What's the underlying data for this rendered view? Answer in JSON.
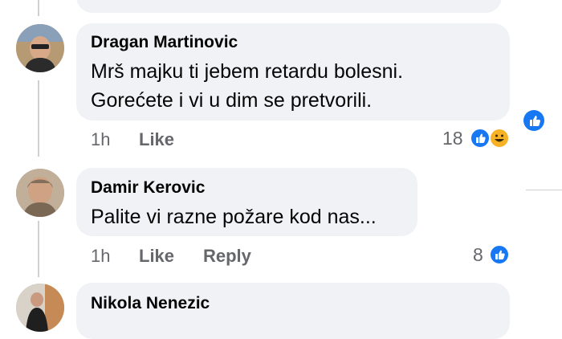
{
  "comments": [
    {
      "author": "Dragan Martinovic",
      "lines": [
        "Mrš majku ti jebem retardu bolesni.",
        "Gorećete i vi  u dim se pretvorili."
      ],
      "time": "1h",
      "like_label": "Like",
      "reaction_count": "18",
      "reactions": [
        "like-icon",
        "haha-icon"
      ]
    },
    {
      "author": "Damir Kerovic",
      "lines": [
        "Palite vi razne požare kod nas..."
      ],
      "time": "1h",
      "like_label": "Like",
      "reply_label": "Reply",
      "reaction_count": "8",
      "reactions": [
        "like-icon"
      ]
    },
    {
      "author": "Nikola Nenezic"
    }
  ],
  "colors": {
    "bubble": "#f0f2f5",
    "meta_text": "#65676b",
    "like_blue": "#1877f2",
    "haha_yellow": "#f7b125"
  }
}
